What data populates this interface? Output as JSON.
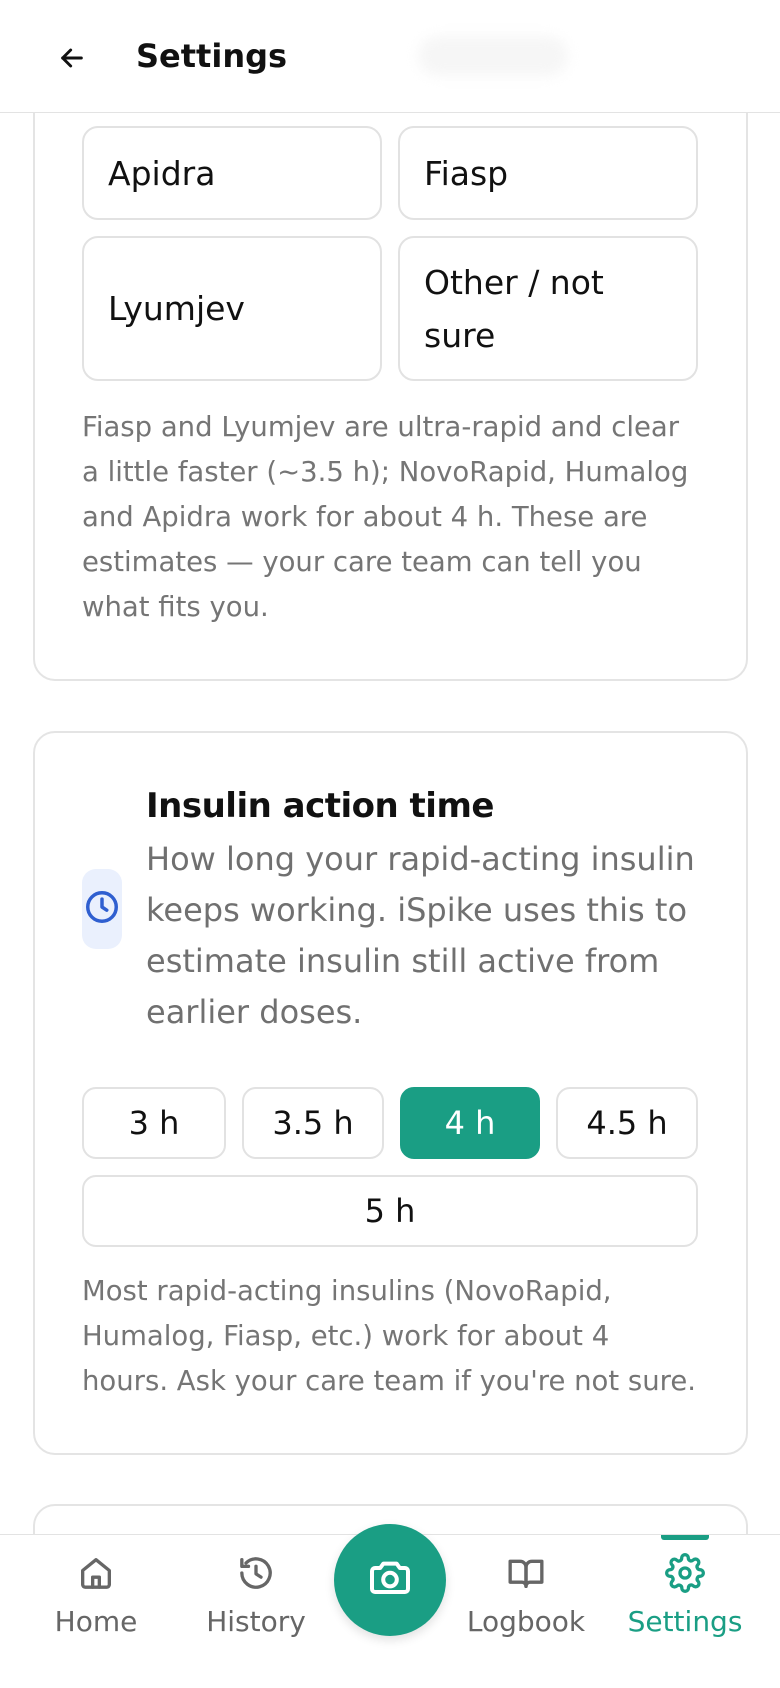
{
  "header": {
    "title": "Settings"
  },
  "insulin_brand": {
    "options": [
      "Apidra",
      "Fiasp",
      "Lyumjev",
      "Other / not sure"
    ],
    "note": "Fiasp and Lyumjev are ultra-rapid and clear a little faster (~3.5 h); NovoRapid, Humalog and Apidra work for about 4 h. These are estimates — your care team can tell you what fits you."
  },
  "insulin_action": {
    "title": "Insulin action time",
    "description": "How long your rapid-acting insulin keeps working. iSpike uses this to estimate insulin still active from earlier doses.",
    "options": [
      "3 h",
      "3.5 h",
      "4 h",
      "4.5 h",
      "5 h"
    ],
    "selected": "4 h",
    "note": "Most rapid-acting insulins (NovoRapid, Humalog, Fiasp, etc.) work for about 4 hours. Ask your care team if you're not sure."
  },
  "nav": {
    "items": [
      {
        "label": "Home",
        "icon": "home-icon"
      },
      {
        "label": "History",
        "icon": "history-icon"
      },
      {
        "label": "Logbook",
        "icon": "book-icon"
      },
      {
        "label": "Settings",
        "icon": "gear-icon"
      }
    ],
    "active": "Settings",
    "center_action_icon": "camera-icon"
  },
  "colors": {
    "accent": "#1a9e84",
    "icon_blue": "#2f5fd0",
    "muted_text": "#757575",
    "border": "#e2e2e2"
  }
}
